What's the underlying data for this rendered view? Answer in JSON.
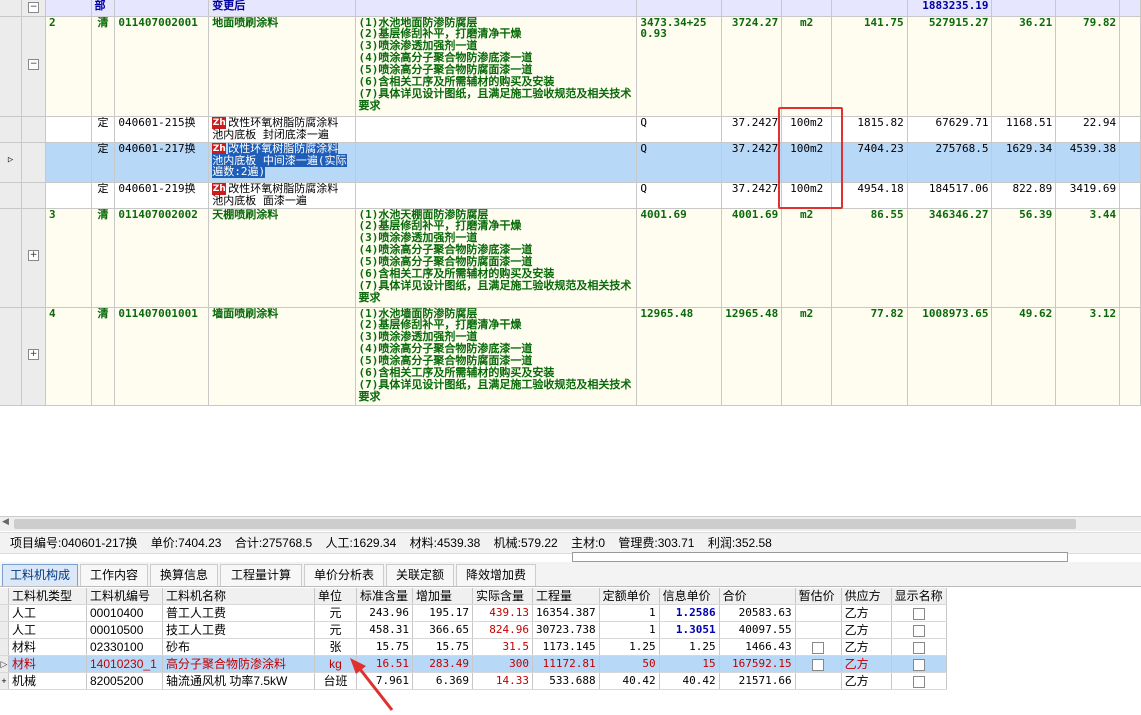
{
  "upper": {
    "part_row": {
      "type": "部",
      "name": "变更后",
      "total": "1883235.19"
    },
    "items": [
      {
        "kind": "qing",
        "no": "2",
        "type": "清",
        "code": "011407002001",
        "name": "地面喷刷涂料",
        "desc": [
          "(1)水池地面防渗防腐层",
          "(2)基层修刮补平，打磨清净干燥",
          "(3)喷涂渗透加强剂一道",
          "(4)喷涂高分子聚合物防渗底漆一道",
          "(5)喷涂高分子聚合物防腐面漆一道",
          "(6)含相关工序及所需辅材的购买及安装",
          "(7)具体详见设计图纸，且满足施工验收规范及相关技术要求"
        ],
        "expr": "3473.34+250.93",
        "qty": "3724.27",
        "unit": "m2",
        "price": "141.75",
        "sum": "527915.27",
        "labor": "36.21",
        "mat": "79.82",
        "toggle": "−"
      },
      {
        "kind": "ding",
        "type": "定",
        "code": "040601-215换",
        "name": "改性环氧树脂防腐涂料 池内底板 封闭底漆一遍",
        "expr": "Q",
        "qty": "37.2427",
        "unit": "100m2",
        "price": "1815.82",
        "sum": "67629.71",
        "labor": "1168.51",
        "mat": "22.94"
      },
      {
        "kind": "ding",
        "sel": true,
        "type": "定",
        "code": "040601-217换",
        "name": "改性环氧树脂防腐涂料 池内底板 中间漆一遍(实际遍数:2遍)",
        "expr": "Q",
        "qty": "37.2427",
        "unit": "100m2",
        "price": "7404.23",
        "sum": "275768.5",
        "labor": "1629.34",
        "mat": "4539.38"
      },
      {
        "kind": "ding",
        "type": "定",
        "code": "040601-219换",
        "name": "改性环氧树脂防腐涂料 池内底板 面漆一遍",
        "expr": "Q",
        "qty": "37.2427",
        "unit": "100m2",
        "price": "4954.18",
        "sum": "184517.06",
        "labor": "822.89",
        "mat": "3419.69"
      },
      {
        "kind": "qing",
        "no": "3",
        "type": "清",
        "code": "011407002002",
        "name": "天棚喷刷涂料",
        "desc": [
          "(1)水池天棚面防渗防腐层",
          "(2)基层修刮补平，打磨清净干燥",
          "(3)喷涂渗透加强剂一道",
          "(4)喷涂高分子聚合物防渗底漆一道",
          "(5)喷涂高分子聚合物防腐面漆一道",
          "(6)含相关工序及所需辅材的购买及安装",
          "(7)具体详见设计图纸，且满足施工验收规范及相关技术要求"
        ],
        "expr": "4001.69",
        "qty": "4001.69",
        "unit": "m2",
        "price": "86.55",
        "sum": "346346.27",
        "labor": "56.39",
        "mat": "3.44",
        "toggle": "+"
      },
      {
        "kind": "qing",
        "no": "4",
        "type": "清",
        "code": "011407001001",
        "name": "墙面喷刷涂料",
        "desc": [
          "(1)水池墙面防渗防腐层",
          "(2)基层修刮补平，打磨清净干燥",
          "(3)喷涂渗透加强剂一道",
          "(4)喷涂高分子聚合物防渗底漆一道",
          "(5)喷涂高分子聚合物防腐面漆一道",
          "(6)含相关工序及所需辅材的购买及安装",
          "(7)具体详见设计图纸，且满足施工验收规范及相关技术要求"
        ],
        "expr": "12965.48",
        "qty": "12965.48",
        "unit": "m2",
        "price": "77.82",
        "sum": "1008973.65",
        "labor": "49.62",
        "mat": "3.12",
        "toggle": "+"
      }
    ]
  },
  "info": {
    "code": "项目编号:040601-217换",
    "price": "单价:7404.23",
    "total": "合计:275768.5",
    "labor": "人工:1629.34",
    "material": "材料:4539.38",
    "machine": "机械:579.22",
    "main": "主材:0",
    "mgmt": "管理费:303.71",
    "profit": "利润:352.58"
  },
  "tabs": [
    "工料机构成",
    "工作内容",
    "换算信息",
    "工程量计算",
    "单价分析表",
    "关联定额",
    "降效增加费"
  ],
  "lower": {
    "headers": [
      "工料机类型",
      "工料机编号",
      "工料机名称",
      "单位",
      "标准含量",
      "增加量",
      "实际含量",
      "工程量",
      "定额单价",
      "信息单价",
      "合价",
      "暂估价",
      "供应方",
      "显示名称"
    ],
    "rows": [
      {
        "type": "人工",
        "code": "00010400",
        "name": "普工人工费",
        "unit": "元",
        "std": "243.96",
        "add": "195.17",
        "act": "439.13",
        "qty": "16354.387",
        "dprice": "1",
        "iprice": "1.2586",
        "sum": "20583.63",
        "supplier": "乙方"
      },
      {
        "type": "人工",
        "code": "00010500",
        "name": "技工人工费",
        "unit": "元",
        "std": "458.31",
        "add": "366.65",
        "act": "824.96",
        "qty": "30723.738",
        "dprice": "1",
        "iprice": "1.3051",
        "sum": "40097.55",
        "supplier": "乙方"
      },
      {
        "type": "材料",
        "code": "02330100",
        "name": "砂布",
        "unit": "张",
        "std": "15.75",
        "add": "15.75",
        "act": "31.5",
        "qty": "1173.145",
        "dprice": "1.25",
        "iprice": "1.25",
        "sum": "1466.43",
        "supplier": "乙方"
      },
      {
        "type": "材料",
        "code": "14010230_1",
        "name": "高分子聚合物防渗涂料",
        "unit": "kg",
        "std": "16.51",
        "add": "283.49",
        "act": "300",
        "qty": "11172.81",
        "dprice": "50",
        "iprice": "15",
        "sum": "167592.15",
        "supplier": "乙方"
      },
      {
        "type": "机械",
        "code": "82005200",
        "name": "轴流通风机 功率7.5kW",
        "unit": "台班",
        "std": "7.961",
        "add": "6.369",
        "act": "14.33",
        "qty": "533.688",
        "dprice": "40.42",
        "iprice": "40.42",
        "sum": "21571.66",
        "supplier": "乙方"
      }
    ]
  },
  "colors": {
    "qing_text": "#0a6a0a",
    "part_text": "#0000a0",
    "selection": "#b8d8f8",
    "annotation": "#e03030"
  }
}
